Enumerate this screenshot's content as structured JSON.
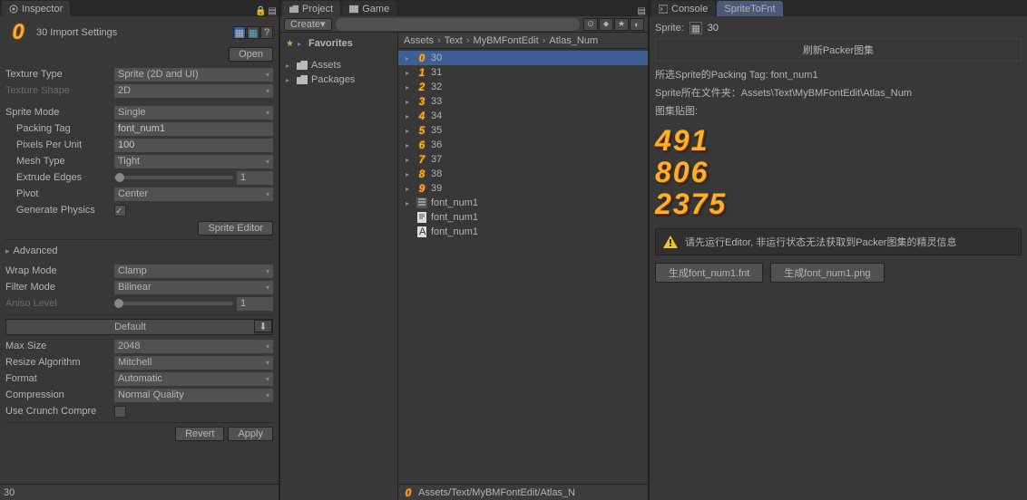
{
  "inspector": {
    "tab": "Inspector",
    "title": "30 Import Settings",
    "open_btn": "Open",
    "texture_type_label": "Texture Type",
    "texture_type": "Sprite (2D and UI)",
    "texture_shape_label": "Texture Shape",
    "texture_shape": "2D",
    "sprite_mode_label": "Sprite Mode",
    "sprite_mode": "Single",
    "packing_tag_label": "Packing Tag",
    "packing_tag": "font_num1",
    "ppu_label": "Pixels Per Unit",
    "ppu": "100",
    "mesh_type_label": "Mesh Type",
    "mesh_type": "Tight",
    "extrude_label": "Extrude Edges",
    "extrude": "1",
    "pivot_label": "Pivot",
    "pivot": "Center",
    "gen_physics_label": "Generate Physics",
    "sprite_editor_btn": "Sprite Editor",
    "advanced": "Advanced",
    "wrap_mode_label": "Wrap Mode",
    "wrap_mode": "Clamp",
    "filter_mode_label": "Filter Mode",
    "filter_mode": "Bilinear",
    "aniso_label": "Aniso Level",
    "aniso": "1",
    "default_tab": "Default",
    "max_size_label": "Max Size",
    "max_size": "2048",
    "resize_label": "Resize Algorithm",
    "resize": "Mitchell",
    "format_label": "Format",
    "format": "Automatic",
    "compression_label": "Compression",
    "compression": "Normal Quality",
    "crunch_label": "Use Crunch Compre",
    "revert_btn": "Revert",
    "apply_btn": "Apply",
    "footer": "30"
  },
  "project": {
    "tab_project": "Project",
    "tab_game": "Game",
    "create_btn": "Create",
    "favorites": "Favorites",
    "assets": "Assets",
    "packages": "Packages",
    "breadcrumb": [
      "Assets",
      "Text",
      "MyBMFontEdit",
      "Atlas_Num"
    ],
    "items": [
      {
        "glyph": "0",
        "name": "30",
        "selected": true
      },
      {
        "glyph": "1",
        "name": "31"
      },
      {
        "glyph": "2",
        "name": "32"
      },
      {
        "glyph": "3",
        "name": "33"
      },
      {
        "glyph": "4",
        "name": "34"
      },
      {
        "glyph": "5",
        "name": "35"
      },
      {
        "glyph": "6",
        "name": "36"
      },
      {
        "glyph": "7",
        "name": "37"
      },
      {
        "glyph": "8",
        "name": "38"
      },
      {
        "glyph": "9",
        "name": "39"
      }
    ],
    "files": [
      "font_num1",
      "font_num1",
      "font_num1"
    ],
    "footer_path": "Assets/Text/MyBMFontEdit/Atlas_N"
  },
  "console": {
    "tab": "Console"
  },
  "sprite_panel": {
    "tab": "SpriteToFnt",
    "sprite_label": "Sprite:",
    "sprite_value": "30",
    "refresh_header": "刷新Packer图集",
    "packing_tag_line": "所选Sprite的Packing Tag: font_num1",
    "folder_line": "Sprite所在文件夹：Assets\\Text\\MyBMFontEdit\\Atlas_Num",
    "atlas_label": "图集贴图:",
    "preview_lines": [
      "491",
      "806",
      "2375"
    ],
    "warning": "请先运行Editor, 非运行状态无法获取到Packer图集的精灵信息",
    "gen_fnt_btn": "生成font_num1.fnt",
    "gen_png_btn": "生成font_num1.png"
  }
}
